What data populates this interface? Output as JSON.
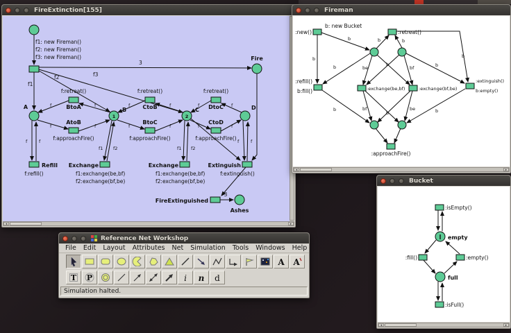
{
  "desktop": {
    "note": ""
  },
  "fire": {
    "title": "FireExtinction[155]",
    "decl1": "f1: new Fireman()",
    "decl2": "f2: new Fireman()",
    "decl3": "f3: new Fireman()",
    "f": "f",
    "f1": "f1",
    "f2": "f2",
    "f3": "f3",
    "weight3": "3",
    "fire_label": "Fire",
    "retreat": "f:retreat()",
    "approach": "f:approachFire()",
    "BtoA": "BtoA",
    "AtoB": "AtoB",
    "CtoB": "CtoB",
    "BtoC": "BtoC",
    "DtoC": "DtoC",
    "CtoD": "CtoD",
    "A": "A",
    "B": "B",
    "C": "C",
    "D": "D",
    "tok_b": "1",
    "tok_c": "2",
    "refill_label": "Refill",
    "refill_code": "f:refill()",
    "exchange_label": "Exchange",
    "exchange1": "f1:exchange(be,bf)",
    "exchange2": "f2:exchange(bf,be)",
    "extinguish_label": "Extinguish",
    "extinguish_code": "f:extinguish()",
    "fire_extinguished": "FireExtinguished",
    "ashes": "Ashes"
  },
  "fireman": {
    "title": "Fireman",
    "new": ":new()",
    "new_bucket": "b: new Bucket",
    "retreat": ":retreat()",
    "refill": ":refill()",
    "bfill": "b:fill()",
    "exch1": ":exchange(be,bf)",
    "exch2": ":exchange(bf,be)",
    "exting": ":extinguish()",
    "bempty": "b:empty()",
    "approach": ":approachFire()",
    "b": "b",
    "be": "be",
    "bf": "bf"
  },
  "bucket": {
    "title": "Bucket",
    "isempty": ":isEmpty()",
    "fill": ":fill()",
    "empty_t": ":empty()",
    "isfull": ":isFull()",
    "empty_p": "empty",
    "full_p": "full"
  },
  "workshop": {
    "title": "Reference Net Workshop",
    "menus": [
      "File",
      "Edit",
      "Layout",
      "Attributes",
      "Net",
      "Simulation",
      "Tools",
      "Windows",
      "Help"
    ],
    "status": "Simulation halted.",
    "letters": {
      "a": "A",
      "a2": "A",
      "t": "T",
      "p": "P",
      "i": "i",
      "n": "n",
      "d": "d"
    },
    "tools_row1": [
      "selection",
      "rectangle",
      "rounded-rectangle",
      "ellipse",
      "pie",
      "polygon",
      "triangle",
      "line",
      "arrow",
      "polyline",
      "connector",
      "flag",
      "image",
      "text",
      "text-edit"
    ],
    "tools_row2": [
      "transition",
      "place",
      "virtual-place",
      "arc",
      "arc-arrow",
      "double-arc",
      "bold-arc",
      "inscription",
      "name",
      "declaration"
    ]
  }
}
